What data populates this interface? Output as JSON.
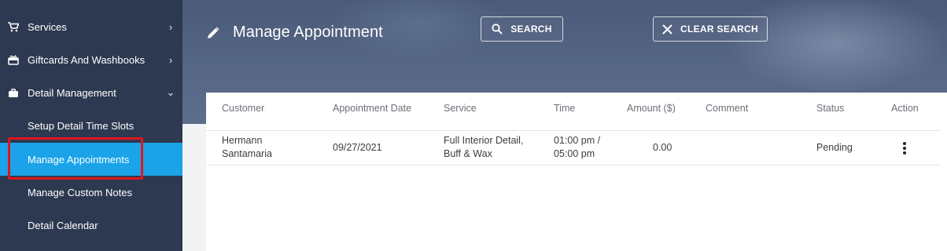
{
  "sidebar": {
    "items": [
      {
        "label": "Services",
        "icon": "cart-icon"
      },
      {
        "label": "Giftcards And Washbooks",
        "icon": "gift-icon"
      },
      {
        "label": "Detail Management",
        "icon": "briefcase-icon"
      }
    ],
    "subitems": [
      {
        "label": "Setup Detail Time Slots"
      },
      {
        "label": "Manage Appointments"
      },
      {
        "label": "Manage Custom Notes"
      },
      {
        "label": "Detail Calendar"
      }
    ]
  },
  "header": {
    "title": "Manage Appointment",
    "search_label": "SEARCH",
    "clear_label": "CLEAR SEARCH"
  },
  "table": {
    "columns": [
      "Customer",
      "Appointment Date",
      "Service",
      "Time",
      "Amount ($)",
      "Comment",
      "Status",
      "Action"
    ],
    "rows": [
      {
        "customer_line1": "Hermann",
        "customer_line2": "Santamaria",
        "date": "09/27/2021",
        "service_line1": "Full Interior Detail,",
        "service_line2": "Buff & Wax",
        "time_line1": "01:00 pm /",
        "time_line2": "05:00 pm",
        "amount": "0.00",
        "comment": "",
        "status": "Pending"
      }
    ]
  },
  "colors": {
    "sidebar_bg": "#2d3950",
    "active_bg": "#1aa3e8",
    "highlight": "#e0151c"
  }
}
